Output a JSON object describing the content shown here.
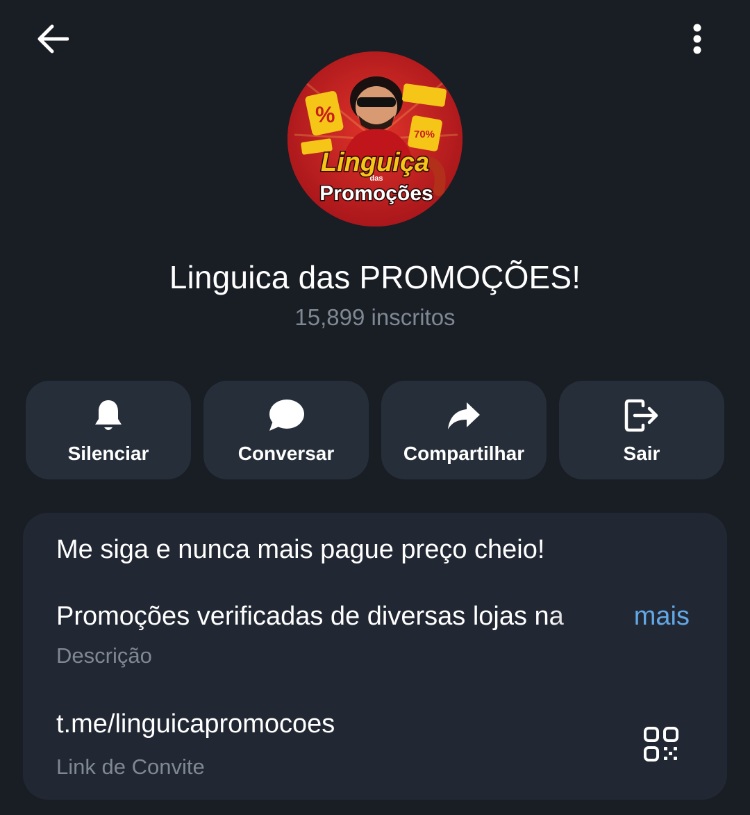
{
  "header": {
    "back_icon": "arrow-left-icon",
    "menu_icon": "more-vertical-icon"
  },
  "channel": {
    "title": "Linguica das PROMOÇÕES!",
    "subscribers": "15,899 inscritos",
    "avatar_logo_text_line1": "Linguiça",
    "avatar_logo_text_line2": "das",
    "avatar_logo_text_line3": "Promoções",
    "avatar_badge_percent": "%",
    "avatar_badge_off": "70%",
    "avatar_colors": {
      "background": "#c81e1e",
      "logo_yellow": "#f5c518",
      "logo_white": "#ffffff"
    }
  },
  "actions": [
    {
      "label": "Silenciar",
      "icon": "bell-icon"
    },
    {
      "label": "Conversar",
      "icon": "chat-bubble-icon"
    },
    {
      "label": "Compartilhar",
      "icon": "share-arrow-icon"
    },
    {
      "label": "Sair",
      "icon": "exit-icon"
    }
  ],
  "info": {
    "description_line1": "Me siga e nunca mais pague preço cheio!",
    "description_line2": "Promoções verificadas de diversas lojas na",
    "more_label": "mais",
    "description_caption": "Descrição",
    "invite_link": "t.me/linguicapromocoes",
    "invite_caption": "Link de Convite",
    "qr_icon": "qr-code-icon"
  },
  "colors": {
    "background": "#191d24",
    "button_bg": "#262e39",
    "card_bg": "#222833",
    "secondary_text": "#7f8893",
    "link_accent": "#62a8e6"
  }
}
